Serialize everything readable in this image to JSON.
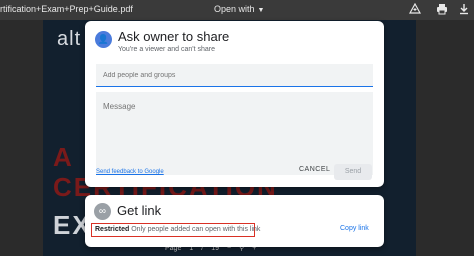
{
  "viewer": {
    "file_name": "rtification+Exam+Prep+Guide.pdf",
    "open_with": "Open with",
    "icons": [
      "add-to-drive-icon",
      "print-icon",
      "download-icon"
    ]
  },
  "document": {
    "brand": "alt",
    "line1": "A",
    "line2": "CERTIFICATION",
    "line3": "EX"
  },
  "pagebar": {
    "page_label": "Page",
    "page_current": "1",
    "page_sep": "/",
    "page_total": "19"
  },
  "ask_dialog": {
    "title": "Ask owner to share",
    "subtitle": "You're a viewer and can't share",
    "people_placeholder": "Add people and groups",
    "message_placeholder": "Message",
    "feedback_link": "Send feedback to Google",
    "cancel_label": "CANCEL",
    "send_label": "Send"
  },
  "get_link": {
    "title": "Get link",
    "restricted_label": "Restricted",
    "restricted_desc": "Only people added can open with this link",
    "copy_link": "Copy link"
  },
  "colors": {
    "accent": "#1a73e8",
    "highlight_border": "#d93025"
  }
}
